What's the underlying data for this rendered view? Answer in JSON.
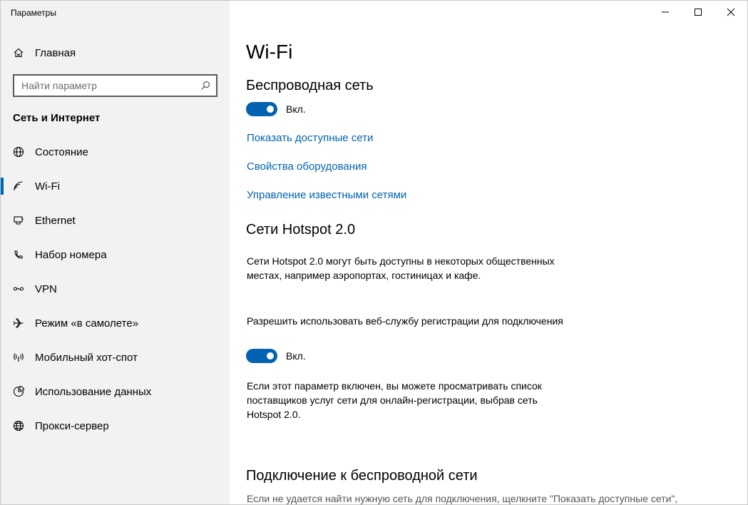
{
  "window": {
    "title": "Параметры",
    "controls": [
      "minimize",
      "maximize",
      "close"
    ]
  },
  "sidebar": {
    "home_label": "Главная",
    "home_icon": "home-icon",
    "search_placeholder": "Найти параметр",
    "search_value": "",
    "section_title": "Сеть и Интернет",
    "items": [
      {
        "label": "Состояние",
        "icon": "globe-status-icon",
        "active": false
      },
      {
        "label": "Wi-Fi",
        "icon": "wifi-icon",
        "active": true
      },
      {
        "label": "Ethernet",
        "icon": "ethernet-icon",
        "active": false
      },
      {
        "label": "Набор номера",
        "icon": "dialup-icon",
        "active": false
      },
      {
        "label": "VPN",
        "icon": "vpn-icon",
        "active": false
      },
      {
        "label": "Режим «в самолете»",
        "icon": "airplane-icon",
        "active": false
      },
      {
        "label": "Мобильный хот-спот",
        "icon": "hotspot-icon",
        "active": false
      },
      {
        "label": "Использование данных",
        "icon": "data-usage-icon",
        "active": false
      },
      {
        "label": "Прокси-сервер",
        "icon": "proxy-globe-icon",
        "active": false
      }
    ]
  },
  "main": {
    "page_title": "Wi-Fi",
    "wireless": {
      "heading": "Беспроводная сеть",
      "toggle_state": "on",
      "toggle_label": "Вкл."
    },
    "links": [
      "Показать доступные сети",
      "Свойства оборудования",
      "Управление известными сетями"
    ],
    "hotspot": {
      "heading": "Сети Hotspot 2.0",
      "description": "Сети Hotspot 2.0 могут быть доступны в некоторых общественных местах, например аэропортах, гостиницах и кафе.",
      "permission_text": "Разрешить использовать веб-службу регистрации для подключения",
      "toggle_state": "on",
      "toggle_label": "Вкл.",
      "info": "Если этот параметр включен, вы можете просматривать список поставщиков услуг сети для онлайн-регистрации, выбрав сеть Hotspot 2.0."
    },
    "connect": {
      "heading": "Подключение к беспроводной сети",
      "text": "Если не удается найти нужную сеть для подключения, щелкните \"Показать доступные сети\","
    }
  },
  "colors": {
    "accent": "#0063b1",
    "sidebar_bg": "#f2f2f2",
    "link": "#0063b1"
  }
}
